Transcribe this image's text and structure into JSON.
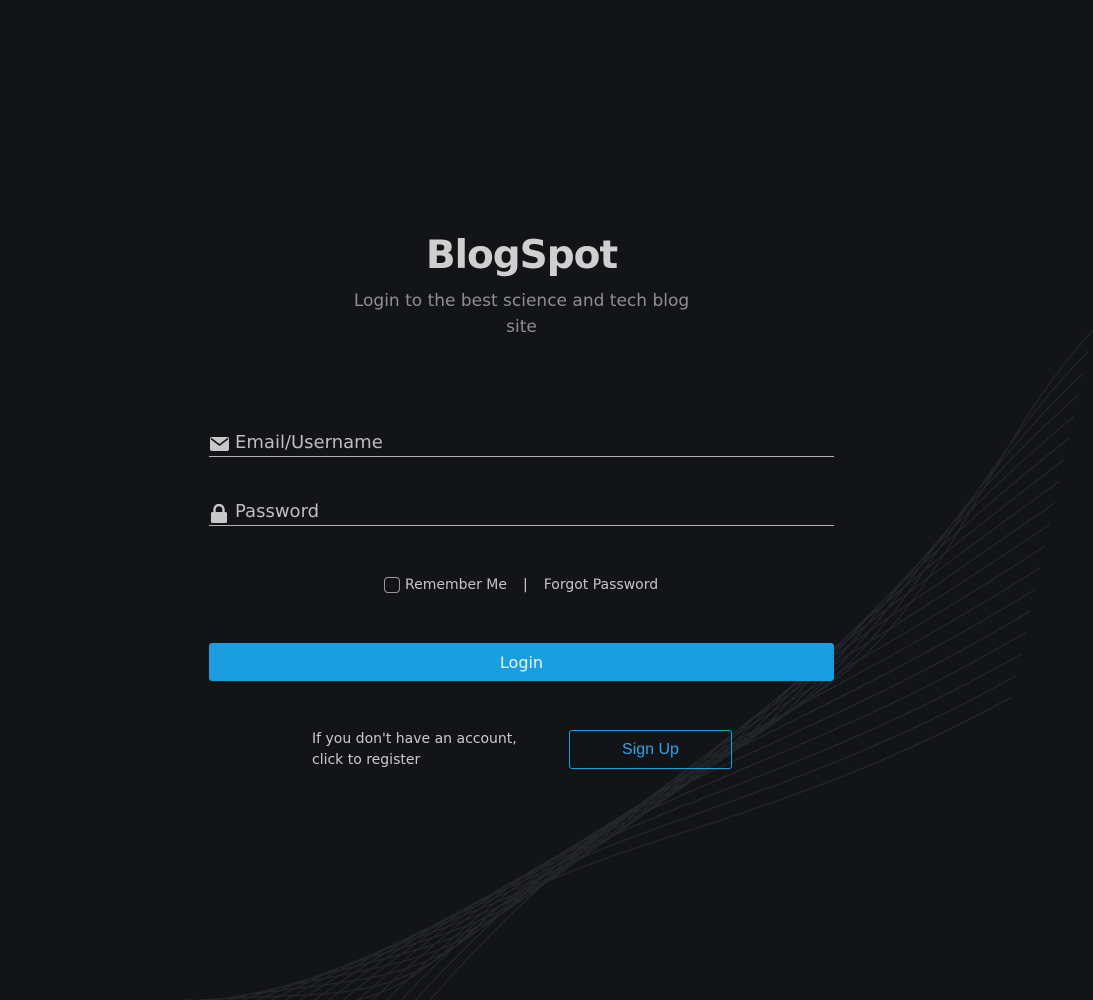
{
  "brand": {
    "title": "BlogSpot",
    "tagline": "Login to the best science and tech blog site"
  },
  "form": {
    "email_placeholder": "Email/Username",
    "email_icon": "envelope-icon",
    "password_placeholder": "Password",
    "password_icon": "lock-icon",
    "remember_label": "Remember Me",
    "separator": "|",
    "forgot_label": "Forgot Password",
    "login_label": "Login"
  },
  "register": {
    "prompt": "If you don't have an account, click to register",
    "signup_label": "Sign Up"
  },
  "colors": {
    "background": "#131418",
    "accent": "#1b9de2",
    "text": "#cfcfcf"
  }
}
